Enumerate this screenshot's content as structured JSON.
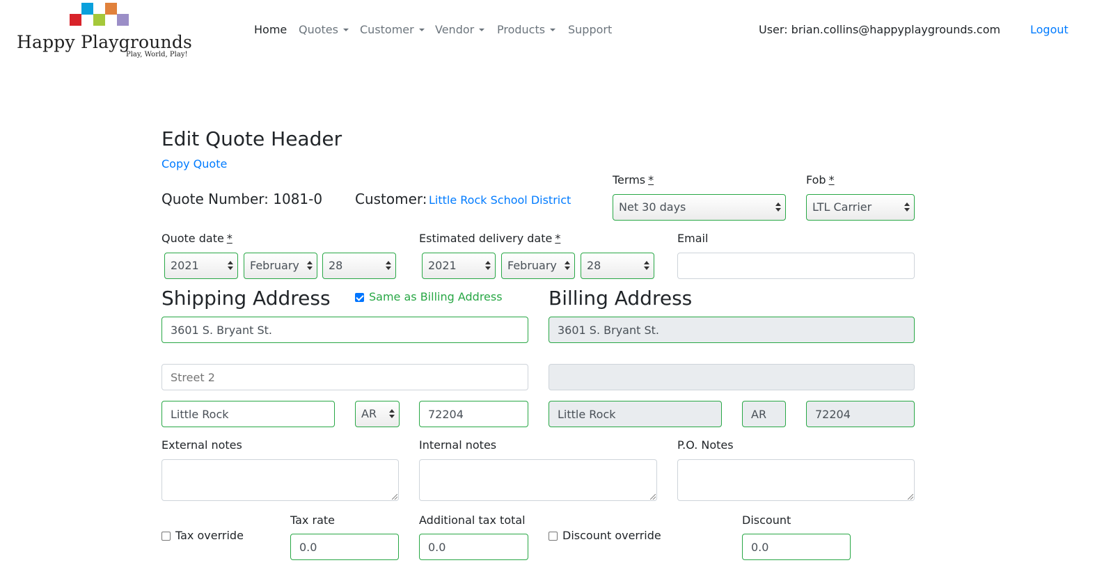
{
  "brand": {
    "name": "Happy Playgrounds",
    "tagline": "Play, World, Play!",
    "colors": [
      "#0aa0dc",
      "#d8232a",
      "#a5c83a",
      "#e1813b",
      "#9b8ec7"
    ]
  },
  "nav": {
    "home": "Home",
    "quotes": "Quotes",
    "customer": "Customer",
    "vendor": "Vendor",
    "products": "Products",
    "support": "Support",
    "user": "User: brian.collins@happyplaygrounds.com",
    "logout": "Logout"
  },
  "page": {
    "title": "Edit Quote Header",
    "copy_quote": "Copy Quote",
    "quote_number": "Quote Number: 1081-0",
    "customer_label": "Customer:",
    "customer_name": "Little Rock School District"
  },
  "terms": {
    "label": "Terms",
    "req": "*",
    "value": "Net 30 days"
  },
  "fob": {
    "label": "Fob",
    "req": "*",
    "value": "LTL Carrier"
  },
  "quote_date": {
    "label": "Quote date",
    "req": "*",
    "year": "2021",
    "month": "February",
    "day": "28"
  },
  "delivery_date": {
    "label": "Estimated delivery date",
    "req": "*",
    "year": "2021",
    "month": "February",
    "day": "28"
  },
  "email": {
    "label": "Email",
    "value": ""
  },
  "shipping": {
    "heading": "Shipping Address",
    "same_as_billing": "Same as Billing Address",
    "same_checked": true,
    "street1": "3601 S. Bryant St.",
    "street2_placeholder": "Street 2",
    "city": "Little Rock",
    "state": "AR",
    "zip": "72204"
  },
  "billing": {
    "heading": "Billing Address",
    "street1": "3601 S. Bryant St.",
    "street2": "",
    "city": "Little Rock",
    "state": "AR",
    "zip": "72204"
  },
  "notes": {
    "external": "External notes",
    "internal": "Internal notes",
    "po": "P.O. Notes"
  },
  "tax": {
    "override_label": "Tax override",
    "rate_label": "Tax rate",
    "rate_value": "0.0",
    "additional_label": "Additional tax total",
    "additional_value": "0.0"
  },
  "discount": {
    "override_label": "Discount override",
    "label": "Discount",
    "value": "0.0"
  }
}
